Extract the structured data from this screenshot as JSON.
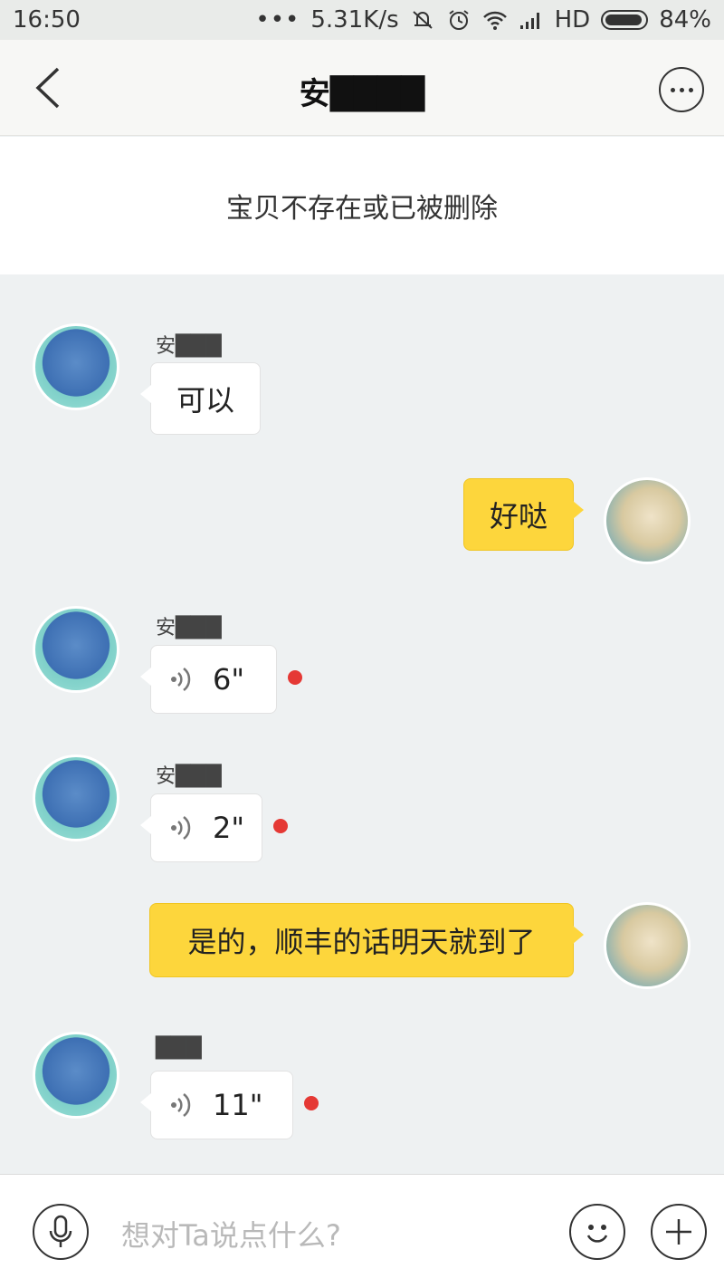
{
  "status_bar": {
    "time": "16:50",
    "dots": "•••",
    "net_speed": "5.31K/s",
    "hd": "HD",
    "battery": "84%",
    "icons": [
      "mute-icon",
      "alarm-icon",
      "wifi-icon",
      "signal-icon",
      "battery-icon"
    ]
  },
  "nav": {
    "title": "安████",
    "icons": [
      "back-chevron-icon",
      "more-icon"
    ]
  },
  "item_card": {
    "text": "宝贝不存在或已被删除"
  },
  "messages": [
    {
      "from": "seller",
      "name": "安███",
      "type": "text",
      "text": "可以"
    },
    {
      "from": "me",
      "type": "text",
      "text": "好哒"
    },
    {
      "from": "seller",
      "name": "安███",
      "type": "voice",
      "duration": "6\"",
      "unread": true
    },
    {
      "from": "seller",
      "name": "安███",
      "type": "voice",
      "duration": "2\"",
      "unread": true
    },
    {
      "from": "me",
      "type": "text",
      "text": "是的，顺丰的话明天就到了"
    },
    {
      "from": "seller",
      "name": "███",
      "type": "voice",
      "duration": "11\"",
      "unread": true
    }
  ],
  "input": {
    "placeholder": "想对Ta说点什么?",
    "icons": [
      "mic-icon",
      "emoji-icon",
      "plus-icon"
    ]
  },
  "colors": {
    "chat_background": "#eef1f2",
    "outgoing_bubble": "#fdd63c",
    "incoming_bubble": "#ffffff",
    "unread_dot": "#e53935"
  }
}
